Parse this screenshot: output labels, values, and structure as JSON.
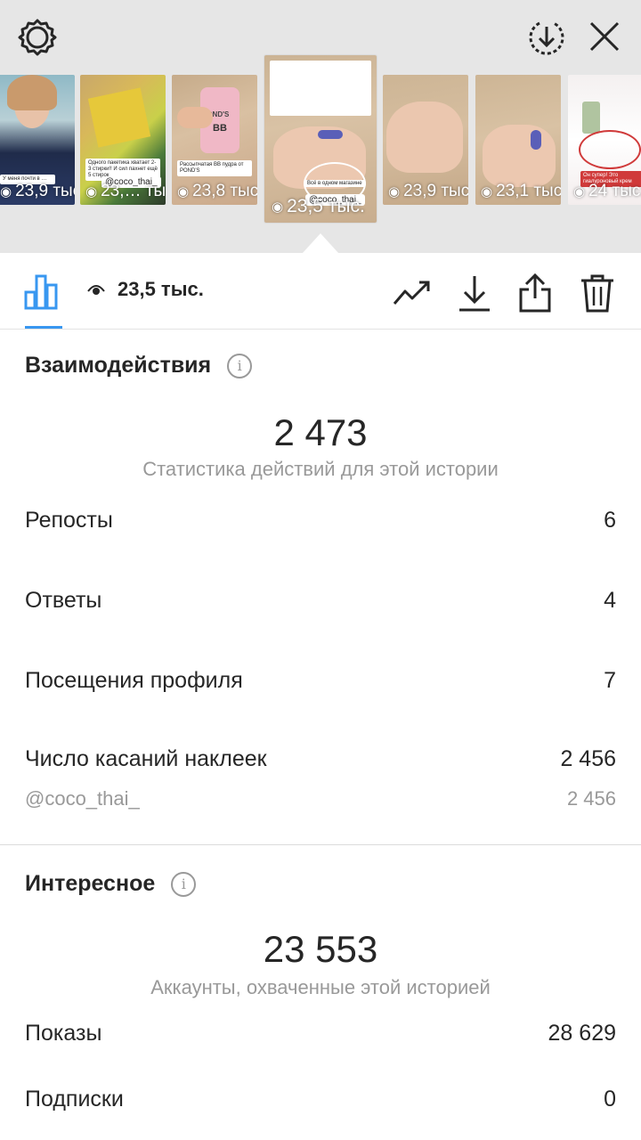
{
  "header": {
    "settings_icon": "gear-icon",
    "save_icon": "download-circle-icon",
    "close_icon": "close-icon"
  },
  "stories": [
    {
      "views": "23,9 тыс.",
      "overlay_text": "У меня почти в …"
    },
    {
      "views": "23,… тыс.",
      "overlay_text": "Одного пакетика хватает 2-3 стирки!! И сил пахнет ещё 5 стирок",
      "tag": "@coco_thai_"
    },
    {
      "views": "23,8 тыс.",
      "overlay_text": "Рассыпчатая ВВ пудра от POND'S",
      "brand": "POND'S",
      "bb": "BB"
    },
    {
      "views": "23,5 тыс.",
      "tag": "@coco_thai_",
      "bubble": "Всё в одном магазине",
      "selected": true
    },
    {
      "views": "23,9 тыс."
    },
    {
      "views": "23,1 тыс."
    },
    {
      "views": "24 тыс.",
      "overlay_text": "Он супер! Это гиалуроновый крем"
    }
  ],
  "toolbar": {
    "views": "23,5 тыс.",
    "stats_icon": "bar-chart-icon",
    "eye_icon": "eye-icon",
    "trend_icon": "trend-icon",
    "download_icon": "download-icon",
    "share_icon": "share-icon",
    "delete_icon": "trash-icon",
    "accent": "#3897f0"
  },
  "interactions": {
    "title": "Взаимодействия",
    "total": "2 473",
    "caption": "Статистика действий для этой истории",
    "rows": [
      {
        "label": "Репосты",
        "value": "6"
      },
      {
        "label": "Ответы",
        "value": "4"
      },
      {
        "label": "Посещения профиля",
        "value": "7"
      },
      {
        "label": "Число касаний наклеек",
        "value": "2 456"
      }
    ],
    "sticker": {
      "label": "@coco_thai_",
      "value": "2 456"
    }
  },
  "discovery": {
    "title": "Интересное",
    "total": "23 553",
    "caption": "Аккаунты, охваченные этой историей",
    "rows": [
      {
        "label": "Показы",
        "value": "28 629"
      },
      {
        "label": "Подписки",
        "value": "0"
      }
    ]
  }
}
